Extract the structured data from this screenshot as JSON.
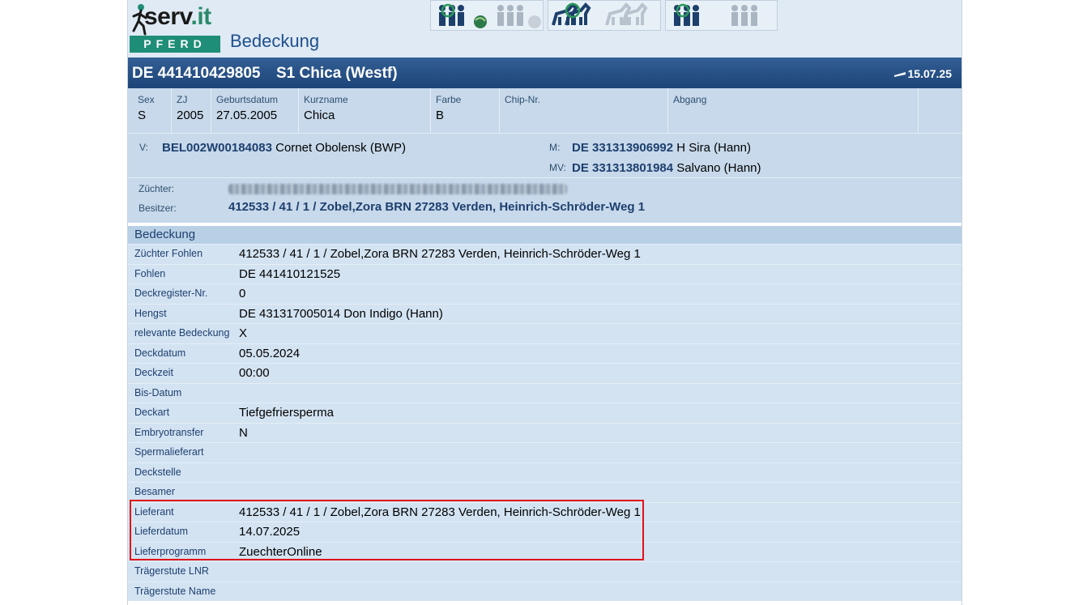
{
  "header": {
    "logo_text_a": "serv",
    "logo_text_b": ".it",
    "logo_sub": "PFERD",
    "page_title": "Bedeckung",
    "toolbar_icons": [
      "people-search-icon",
      "globe-icon",
      "people-icon",
      "globe-icon-disabled",
      "horses-search-icon",
      "horses-icon-disabled",
      "people-search-icon-2",
      "people-icon-disabled"
    ]
  },
  "horse": {
    "id": "DE 441410429805",
    "name": "S1 Chica (Westf)",
    "date": "15.07.25"
  },
  "info": [
    {
      "label": "Sex",
      "value": "S"
    },
    {
      "label": "ZJ",
      "value": "2005"
    },
    {
      "label": "Geburtsdatum",
      "value": "27.05.2005"
    },
    {
      "label": "Kurzname",
      "value": "Chica"
    },
    {
      "label": "Farbe",
      "value": "B"
    },
    {
      "label": "Chip-Nr.",
      "value": ""
    },
    {
      "label": "Abgang",
      "value": ""
    }
  ],
  "parents": {
    "v_label": "V:",
    "v_id": "BEL002W00184083",
    "v_name": "Cornet Obolensk (BWP)",
    "m_label": "M:",
    "m_id": "DE 331313906992",
    "m_name": "H Sira (Hann)",
    "mv_label": "MV:",
    "mv_id": "DE 331313801984",
    "mv_name": "Salvano (Hann)"
  },
  "owners": {
    "zuechter_label": "Züchter:",
    "besitzer_label": "Besitzer:",
    "besitzer_value": "412533 / 41 / 1 / Zobel,Zora BRN 27283 Verden, Heinrich-Schröder-Weg 1"
  },
  "section_title": "Bedeckung",
  "rows": [
    {
      "label": "Züchter Fohlen",
      "value": "412533 / 41 / 1 / Zobel,Zora BRN 27283 Verden, Heinrich-Schröder-Weg 1"
    },
    {
      "label": "Fohlen",
      "value": "DE 441410121525"
    },
    {
      "label": "Deckregister-Nr.",
      "value": "0"
    },
    {
      "label": "Hengst",
      "value": "DE 431317005014 Don Indigo (Hann)"
    },
    {
      "label": "relevante Bedeckung",
      "value": "X"
    },
    {
      "label": "Deckdatum",
      "value": "05.05.2024"
    },
    {
      "label": "Deckzeit",
      "value": "00:00"
    },
    {
      "label": "Bis-Datum",
      "value": ""
    },
    {
      "label": "Deckart",
      "value": "Tiefgefriersperma"
    },
    {
      "label": "Embryotransfer",
      "value": "N"
    },
    {
      "label": "Spermalieferart",
      "value": ""
    },
    {
      "label": "Deckstelle",
      "value": ""
    },
    {
      "label": "Besamer",
      "value": ""
    },
    {
      "label": "Lieferant",
      "value": "412533 / 41 / 1 / Zobel,Zora BRN 27283 Verden, Heinrich-Schröder-Weg 1"
    },
    {
      "label": "Lieferdatum",
      "value": "14.07.2025"
    },
    {
      "label": "Lieferprogramm",
      "value": "ZuechterOnline"
    },
    {
      "label": "Trägerstute LNR",
      "value": ""
    },
    {
      "label": "Trägerstute Name",
      "value": ""
    }
  ],
  "colors": {
    "title_bar": "#1d4478",
    "highlight": "#e0121a",
    "brand_green": "#1f8e78"
  }
}
